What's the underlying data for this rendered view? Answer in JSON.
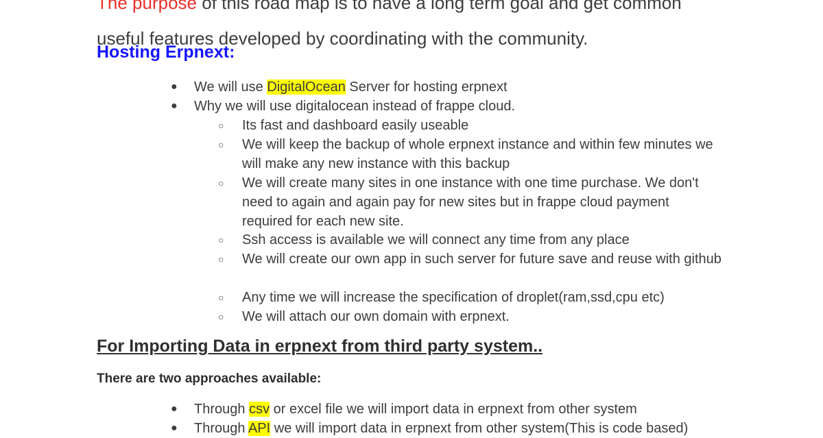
{
  "intro": {
    "line1_red": "The purpose",
    "line1_rest": " of this road map is to have a long term goal and get common",
    "line2": "useful features developed by coordinating with the community."
  },
  "hosting": {
    "heading": "Hosting Erpnext:",
    "bullet1": {
      "pre": "We will use ",
      "hl": "DigitalOcean",
      "post": " Server for hosting erpnext"
    },
    "bullet2": "Why we will use digitalocean instead of frappe cloud.",
    "sub": [
      "Its fast and dashboard easily useable",
      "We  will keep the backup of whole erpnext instance and within few minutes we will make any new instance with this backup",
      "We will create many  sites in one instance with one time purchase. We don't need to again and again pay for new sites but in frappe cloud payment required for each new site.",
      "Ssh access is available we will connect any time from any place",
      "We will create our own app in such server for future save and reuse with github",
      "Any time we will increase the specification of droplet(ram,ssd,cpu etc)",
      "We will attach our own domain with erpnext."
    ]
  },
  "importing": {
    "heading": "For Importing Data in erpnext from third party system..",
    "approaches": "There are two approaches available:",
    "bullet1": {
      "pre": "Through ",
      "hl": "csv",
      "post": " or excel file we will import data in erpnext from other system"
    },
    "bullet2": {
      "pre": "Through ",
      "hl": "API",
      "post": " we will import data in erpnext from other system(This is code based)"
    }
  },
  "bullets": {
    "level1": "●",
    "level2": "○"
  },
  "colors": {
    "heading_blue": "#1515ff",
    "intro_red": "#e8322b",
    "highlight": "#ffff00"
  }
}
